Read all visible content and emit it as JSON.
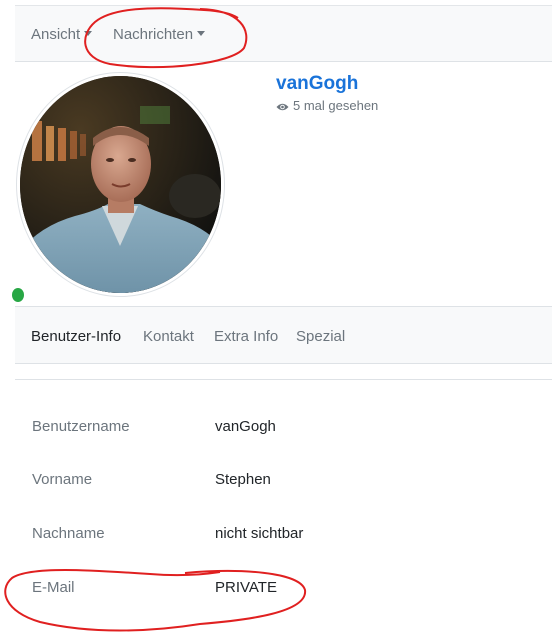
{
  "nav": {
    "items": [
      {
        "label": "Ansicht",
        "icon": "caret-down-icon"
      },
      {
        "label": "Nachrichten",
        "icon": "caret-down-icon"
      }
    ]
  },
  "profile": {
    "username": "vanGogh",
    "views": "5 mal gesehen",
    "online_status_color": "#28a745",
    "username_color": "#1a73d9"
  },
  "tabs": [
    {
      "label": "Benutzer-Info",
      "active": true
    },
    {
      "label": "Kontakt",
      "active": false
    },
    {
      "label": "Extra Info",
      "active": false
    },
    {
      "label": "Spezial",
      "active": false
    }
  ],
  "info": {
    "rows": [
      {
        "label": "Benutzername",
        "value": "vanGogh"
      },
      {
        "label": "Vorname",
        "value": "Stephen"
      },
      {
        "label": "Nachname",
        "value": "nicht sichtbar"
      },
      {
        "label": "E-Mail",
        "value": "PRIVATE"
      }
    ]
  },
  "annotation_color": "#e02020"
}
